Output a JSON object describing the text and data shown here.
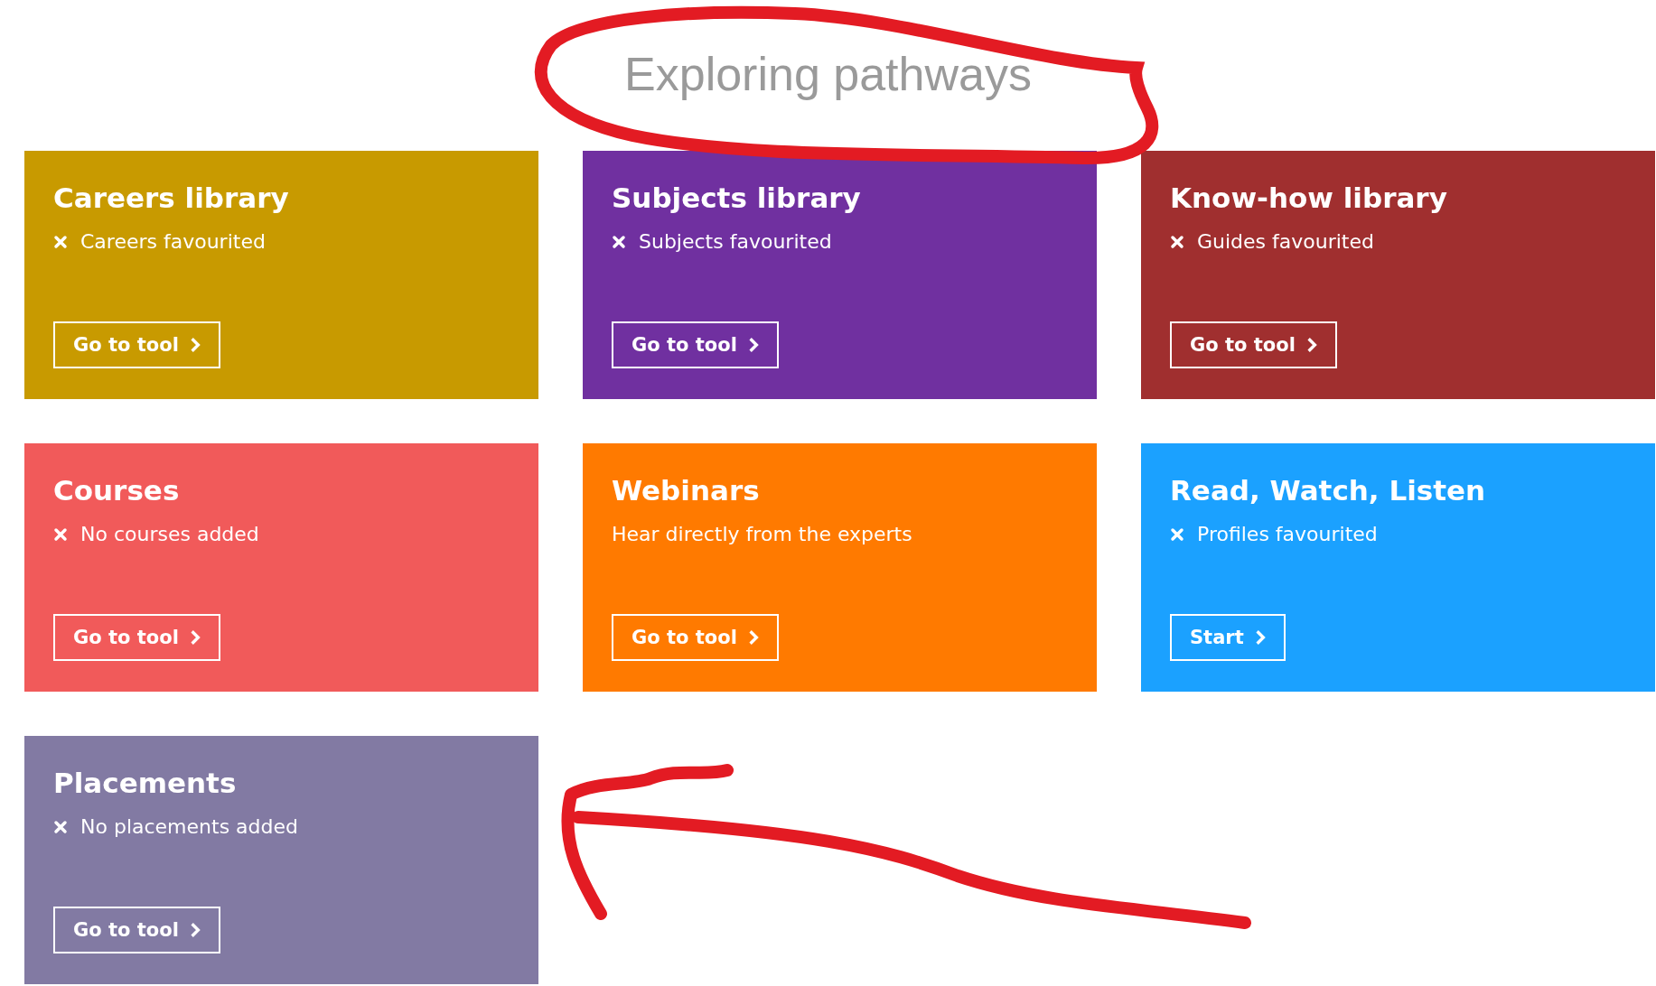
{
  "heading": "Exploring pathways",
  "cards": [
    {
      "title": "Careers library",
      "kind": "status",
      "text": "Careers favourited",
      "button": "Go to tool",
      "color": "#c89a00"
    },
    {
      "title": "Subjects library",
      "kind": "status",
      "text": "Subjects favourited",
      "button": "Go to tool",
      "color": "#7030a0"
    },
    {
      "title": "Know-how library",
      "kind": "status",
      "text": "Guides favourited",
      "button": "Go to tool",
      "color": "#a02f2f"
    },
    {
      "title": "Courses",
      "kind": "status",
      "text": "No courses added",
      "button": "Go to tool",
      "color": "#f15a5a"
    },
    {
      "title": "Webinars",
      "kind": "description",
      "text": "Hear directly from the experts",
      "button": "Go to tool",
      "color": "#ff7a00"
    },
    {
      "title": "Read, Watch, Listen",
      "kind": "status",
      "text": "Profiles favourited",
      "button": "Start",
      "color": "#1ba1ff"
    },
    {
      "title": "Placements",
      "kind": "status",
      "text": "No placements added",
      "button": "Go to tool",
      "color": "#827aa3"
    }
  ]
}
